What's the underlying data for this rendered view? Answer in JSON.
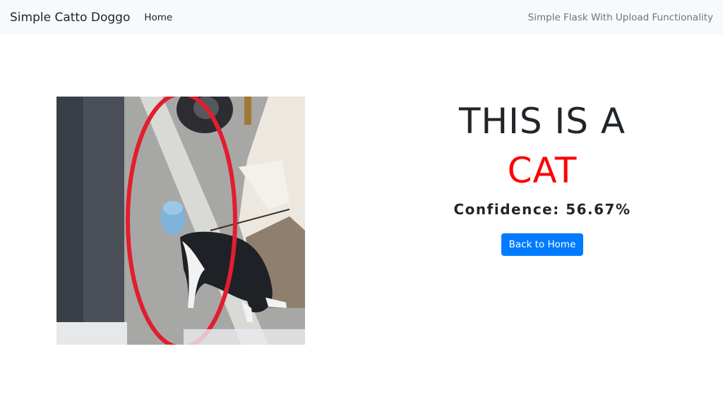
{
  "navbar": {
    "brand": "Simple Catto Doggo",
    "home_label": "Home",
    "right_text": "Simple Flask With Upload Functionality"
  },
  "result": {
    "line1": "THIS IS A",
    "prediction": "CAT",
    "confidence_label": "Confidence:",
    "confidence_value": "56.67%",
    "back_button_label": "Back to Home"
  },
  "colors": {
    "navbar_bg": "#f8f9fa",
    "prediction_color": "#ff0000",
    "button_bg": "#007bff"
  }
}
